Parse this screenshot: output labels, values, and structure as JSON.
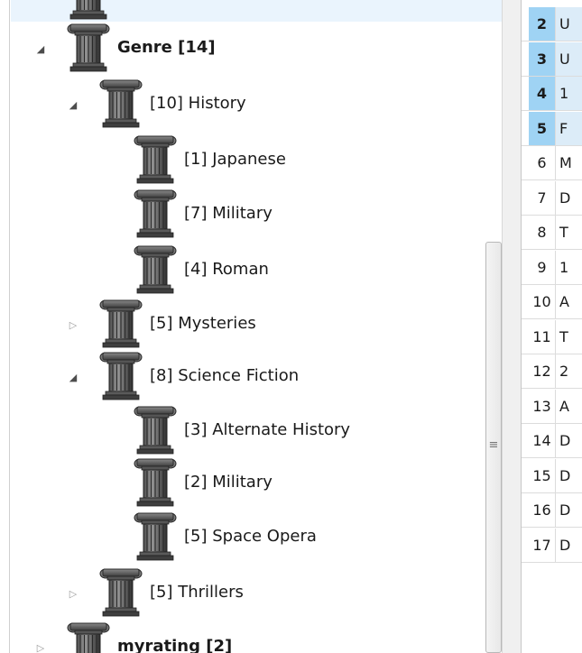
{
  "tree": {
    "nodes": [
      {
        "label": "",
        "expander": "none",
        "bold": true,
        "selected": true,
        "level": 0
      },
      {
        "label": "Genre [14]",
        "expander": "expanded",
        "bold": true,
        "selected": false,
        "level": 0
      },
      {
        "label": "[10] History",
        "expander": "expanded",
        "bold": false,
        "selected": false,
        "level": 1
      },
      {
        "label": "[1] Japanese",
        "expander": "none",
        "bold": false,
        "selected": false,
        "level": 2
      },
      {
        "label": "[7] Military",
        "expander": "none",
        "bold": false,
        "selected": false,
        "level": 2
      },
      {
        "label": "[4] Roman",
        "expander": "none",
        "bold": false,
        "selected": false,
        "level": 2
      },
      {
        "label": "[5] Mysteries",
        "expander": "collapsed",
        "bold": false,
        "selected": false,
        "level": 1
      },
      {
        "label": "[8] Science Fiction",
        "expander": "expanded",
        "bold": false,
        "selected": false,
        "level": 1
      },
      {
        "label": "[3] Alternate History",
        "expander": "none",
        "bold": false,
        "selected": false,
        "level": 2
      },
      {
        "label": "[2] Military",
        "expander": "none",
        "bold": false,
        "selected": false,
        "level": 2
      },
      {
        "label": "[5] Space Opera",
        "expander": "none",
        "bold": false,
        "selected": false,
        "level": 2
      },
      {
        "label": "[5] Thrillers",
        "expander": "collapsed",
        "bold": false,
        "selected": false,
        "level": 1
      },
      {
        "label": "myrating [2]",
        "expander": "collapsed",
        "bold": true,
        "selected": false,
        "level": 0
      }
    ],
    "node_icon": "column-pillar-icon",
    "splitter_grip": "≡"
  },
  "grid": {
    "rows": [
      {
        "num": "2",
        "cell": "U",
        "selected": true
      },
      {
        "num": "3",
        "cell": "U",
        "selected": true
      },
      {
        "num": "4",
        "cell": "1",
        "selected": true
      },
      {
        "num": "5",
        "cell": "F",
        "selected": true
      },
      {
        "num": "6",
        "cell": "M",
        "selected": false
      },
      {
        "num": "7",
        "cell": "D",
        "selected": false
      },
      {
        "num": "8",
        "cell": "T",
        "selected": false
      },
      {
        "num": "9",
        "cell": "1",
        "selected": false
      },
      {
        "num": "10",
        "cell": "A",
        "selected": false
      },
      {
        "num": "11",
        "cell": "T",
        "selected": false
      },
      {
        "num": "12",
        "cell": "2",
        "selected": false
      },
      {
        "num": "13",
        "cell": "A",
        "selected": false
      },
      {
        "num": "14",
        "cell": "D",
        "selected": false
      },
      {
        "num": "15",
        "cell": "D",
        "selected": false
      },
      {
        "num": "16",
        "cell": "D",
        "selected": false
      },
      {
        "num": "17",
        "cell": "D",
        "selected": false
      }
    ]
  },
  "colors": {
    "selection_row": "#eaf4fd",
    "selected_rownum": "#9fd3f4",
    "selected_cell": "#dcecf8"
  }
}
